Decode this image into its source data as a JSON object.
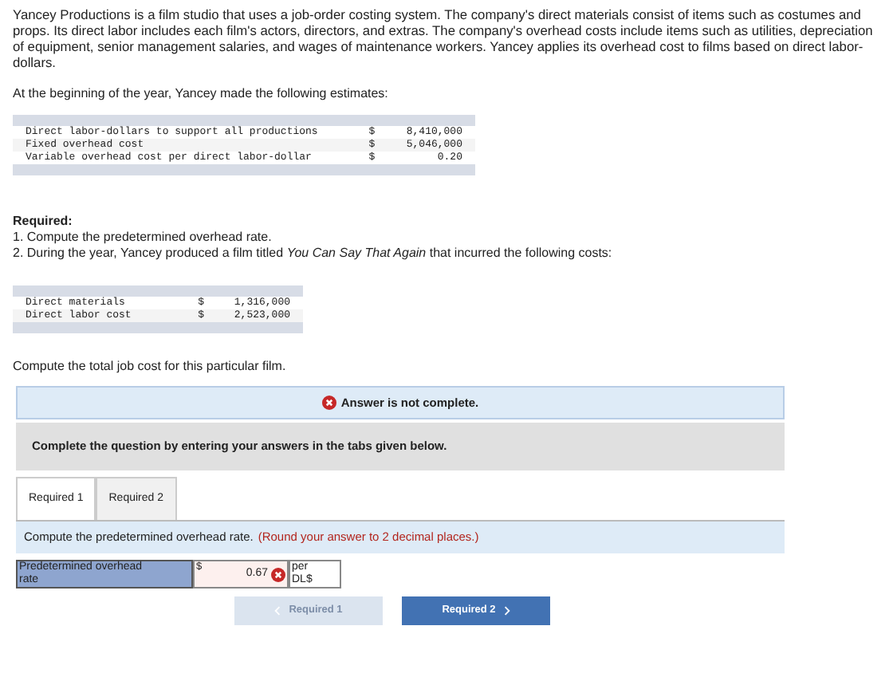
{
  "intro": "Yancey Productions is a film studio that uses a job-order costing system. The company's direct materials consist of items such as costumes and props. Its direct labor includes each film's actors, directors, and extras. The company's overhead costs include items such as utilities, depreciation of equipment, senior management salaries, and wages of maintenance workers. Yancey applies its overhead cost to films based on direct labor-dollars.",
  "estimates_intro": "At the beginning of the year, Yancey made the following estimates:",
  "estimates": [
    {
      "label": "Direct labor-dollars to support all productions",
      "currency": "$",
      "amount": "8,410,000"
    },
    {
      "label": "Fixed overhead cost",
      "currency": "$",
      "amount": "5,046,000"
    },
    {
      "label": "Variable overhead cost per direct labor-dollar",
      "currency": "$",
      "amount": "0.20"
    }
  ],
  "required_heading": "Required:",
  "required_items": [
    "1. Compute the predetermined overhead rate.",
    "2. During the year, Yancey produced a film titled *You Can Say That Again* that incurred the following costs:"
  ],
  "costs": [
    {
      "label": "Direct materials",
      "currency": "$",
      "amount": "1,316,000"
    },
    {
      "label": "Direct labor cost",
      "currency": "$",
      "amount": "2,523,000"
    }
  ],
  "question": "Compute the total job cost for this particular film.",
  "status_banner": "Answer is not complete.",
  "instruction_banner": "Complete the question by entering your answers in the tabs given below.",
  "tabs": [
    {
      "label": "Required 1",
      "selected": true
    },
    {
      "label": "Required 2",
      "selected": false
    }
  ],
  "prompt": "Compute the predetermined overhead rate.",
  "prompt_hint": "(Round your answer to 2 decimal places.)",
  "answer_row": {
    "label": "Predetermined overhead rate",
    "currency": "$",
    "value": "0.67",
    "correct": false,
    "unit": "per DL$"
  },
  "nav_buttons": [
    {
      "label": "Required 1",
      "kind": "prev",
      "disabled": true
    },
    {
      "label": "Required 2",
      "kind": "next",
      "disabled": false
    }
  ]
}
